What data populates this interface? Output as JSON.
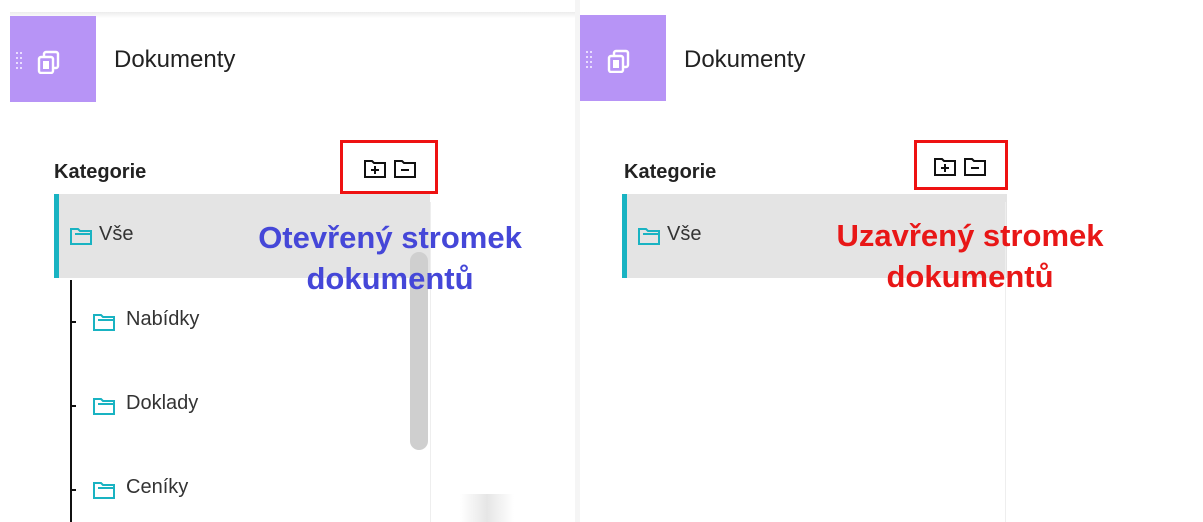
{
  "left_panel": {
    "header_title": "Dokumenty",
    "category_label": "Kategorie",
    "selected_item": "Vše",
    "children": [
      {
        "label": "Nabídky"
      },
      {
        "label": "Doklady"
      },
      {
        "label": "Ceníky"
      }
    ],
    "annotation_line1": "Otevřený stromek",
    "annotation_line2": "dokumentů",
    "annotation_color": "#4547d8",
    "icons": [
      "drag-handle-icon",
      "documents-icon",
      "expand-all-folder-icon",
      "collapse-all-folder-icon",
      "folder-icon"
    ]
  },
  "right_panel": {
    "header_title": "Dokumenty",
    "category_label": "Kategorie",
    "selected_item": "Vše",
    "annotation_line1": "Uzavřený stromek",
    "annotation_line2": "dokumentů",
    "annotation_color": "#e81717"
  },
  "colors": {
    "header_accent": "#b794f6",
    "selection_bar": "#19b3c2",
    "highlight_box": "#ee1111",
    "folder_icon": "#19b3c2"
  }
}
